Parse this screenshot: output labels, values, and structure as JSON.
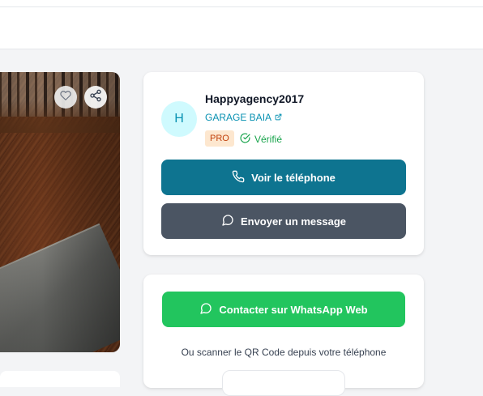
{
  "seller": {
    "avatar_initial": "H",
    "name": "Happyagency2017",
    "shop_link": "GARAGE BAIA",
    "badge": "PRO",
    "verified_label": "Vérifié"
  },
  "actions": {
    "phone_label": "Voir le téléphone",
    "message_label": "Envoyer un message"
  },
  "whatsapp": {
    "button_label": "Contacter sur WhatsApp Web",
    "qr_text": "Ou scanner le QR Code depuis votre téléphone"
  },
  "colors": {
    "phone_button": "#0e7490",
    "message_button": "#4b5563",
    "whatsapp_button": "#22c55e",
    "link": "#0891b2",
    "verified": "#16a34a",
    "pro_badge_bg": "#fde7cf",
    "pro_badge_text": "#c2410c"
  },
  "icons": {
    "favorite": "heart-icon",
    "share": "share-icon",
    "external": "external-link-icon",
    "verified": "check-circle-icon",
    "phone": "phone-icon",
    "message": "chat-bubble-icon",
    "whatsapp": "whatsapp-icon"
  }
}
